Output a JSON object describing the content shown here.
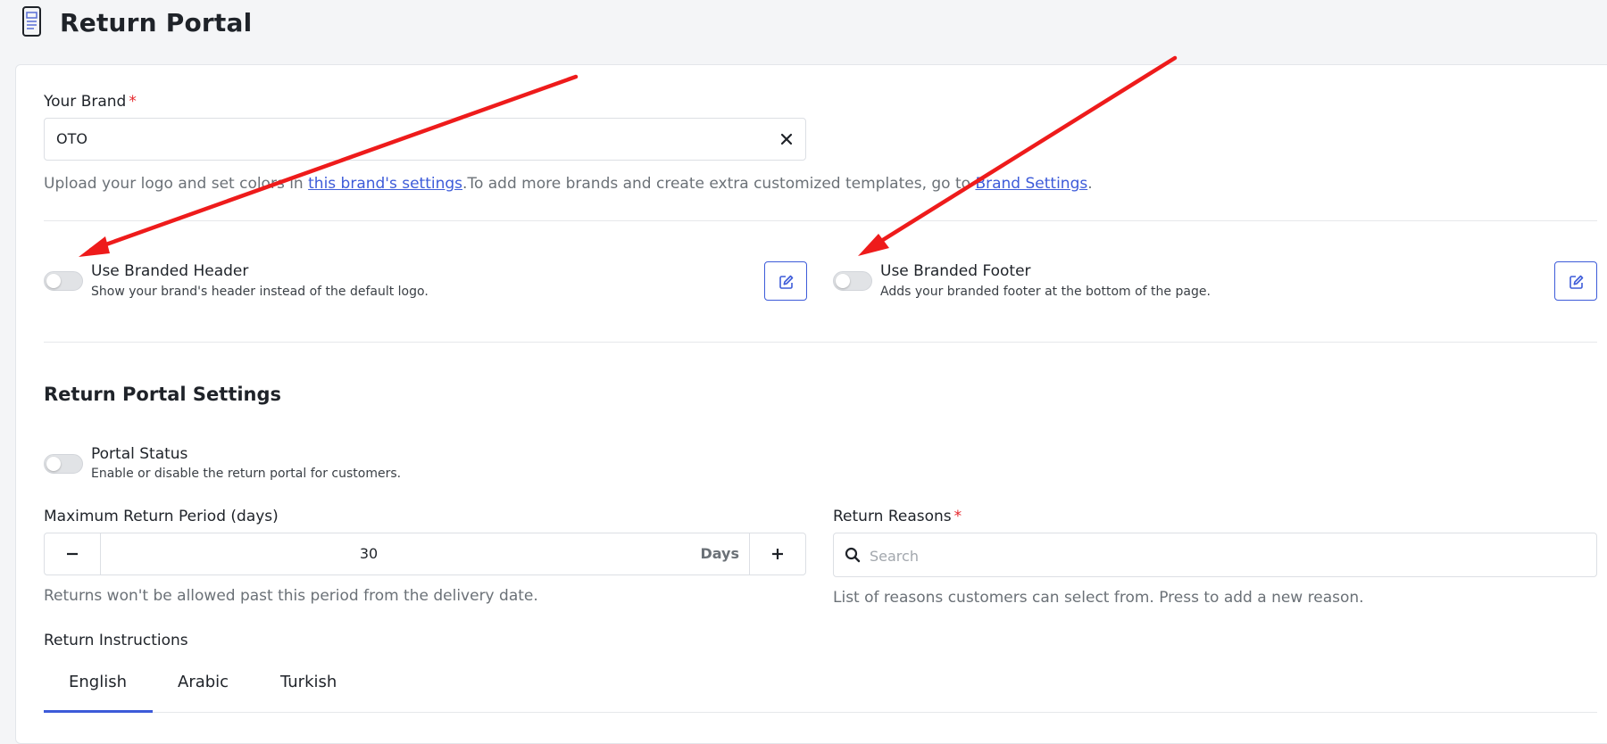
{
  "page": {
    "title": "Return Portal"
  },
  "brand": {
    "label": "Your Brand",
    "required_mark": "*",
    "value": "OTO",
    "help_prefix": "Upload your logo and set colors in ",
    "help_link_1": "this brand's settings",
    "help_middle": ".To add more brands and create extra customized templates, go to ",
    "help_link_2": "Brand Settings",
    "help_suffix": "."
  },
  "branded_header": {
    "title": "Use Branded Header",
    "description": "Show your brand's header instead of the default logo.",
    "enabled": false
  },
  "branded_footer": {
    "title": "Use Branded Footer",
    "description": "Adds your branded footer at the bottom of the page.",
    "enabled": false
  },
  "settings": {
    "title": "Return Portal Settings",
    "portal_status": {
      "title": "Portal Status",
      "description": "Enable or disable the return portal for customers.",
      "enabled": false
    },
    "max_return_period": {
      "label": "Maximum Return Period (days)",
      "value": "30",
      "unit": "Days",
      "help": "Returns won't be allowed past this period from the delivery date."
    },
    "return_reasons": {
      "label": "Return Reasons",
      "required_mark": "*",
      "placeholder": "Search",
      "help": "List of reasons customers can select from. Press to add a new reason."
    },
    "instructions": {
      "label": "Return Instructions",
      "tabs": [
        "English",
        "Arabic",
        "Turkish"
      ],
      "active_tab": "English"
    }
  },
  "colors": {
    "accent": "#3d5bd9",
    "required": "#e5252a",
    "annotation_arrow": "#ee1b1b"
  },
  "icons": {
    "page": "mobile-page-icon",
    "clear": "close-icon",
    "edit": "edit-icon",
    "minus": "minus-icon",
    "plus": "plus-icon",
    "search": "search-icon"
  }
}
